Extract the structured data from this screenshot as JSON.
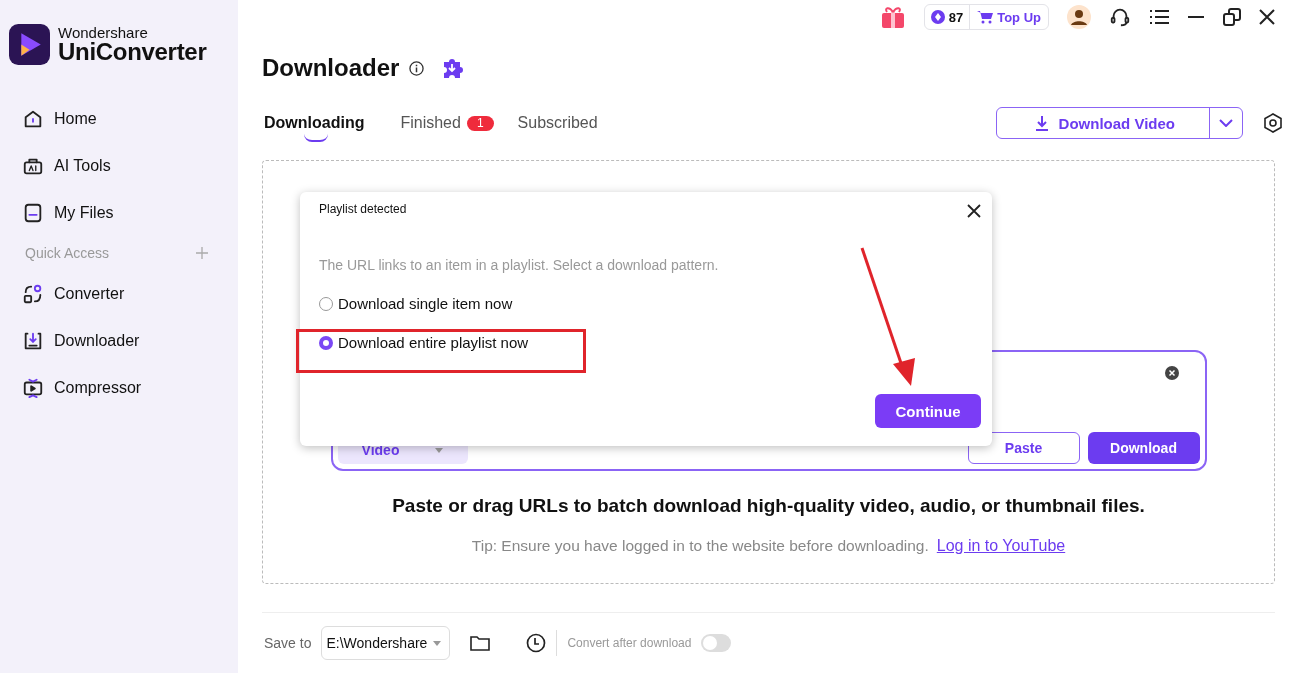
{
  "brand": {
    "company": "Wondershare",
    "product": "UniConverter"
  },
  "sidebar": {
    "items": [
      {
        "label": "Home"
      },
      {
        "label": "AI Tools"
      },
      {
        "label": "My Files"
      }
    ],
    "section": {
      "label": "Quick Access"
    },
    "quick_items": [
      {
        "label": "Converter"
      },
      {
        "label": "Downloader"
      },
      {
        "label": "Compressor"
      }
    ]
  },
  "topbar": {
    "credits": "87",
    "top_up": "Top Up"
  },
  "page": {
    "title": "Downloader"
  },
  "tabs": [
    {
      "label": "Downloading",
      "selected": true
    },
    {
      "label": "Finished",
      "selected": false,
      "badge": "1"
    },
    {
      "label": "Subscribed",
      "selected": false
    }
  ],
  "download_button": {
    "label": "Download Video"
  },
  "url_box": {
    "format": "Video",
    "paste": "Paste",
    "download": "Download"
  },
  "headline": "Paste or drag URLs to batch download high-quality video, audio, or thumbnail files.",
  "tip": {
    "text": "Tip: Ensure you have logged in to the website before downloading.",
    "link": "Log in to YouTube"
  },
  "dialog": {
    "title": "Playlist detected",
    "message": "The URL links to an item in a playlist. Select a download pattern.",
    "options": [
      {
        "label": "Download single item now",
        "selected": false
      },
      {
        "label": "Download entire playlist now",
        "selected": true
      }
    ],
    "button": "Continue"
  },
  "footer": {
    "save_to": "Save to",
    "path": "E:\\Wondershare",
    "convert_label": "Convert after download",
    "convert_on": false
  }
}
